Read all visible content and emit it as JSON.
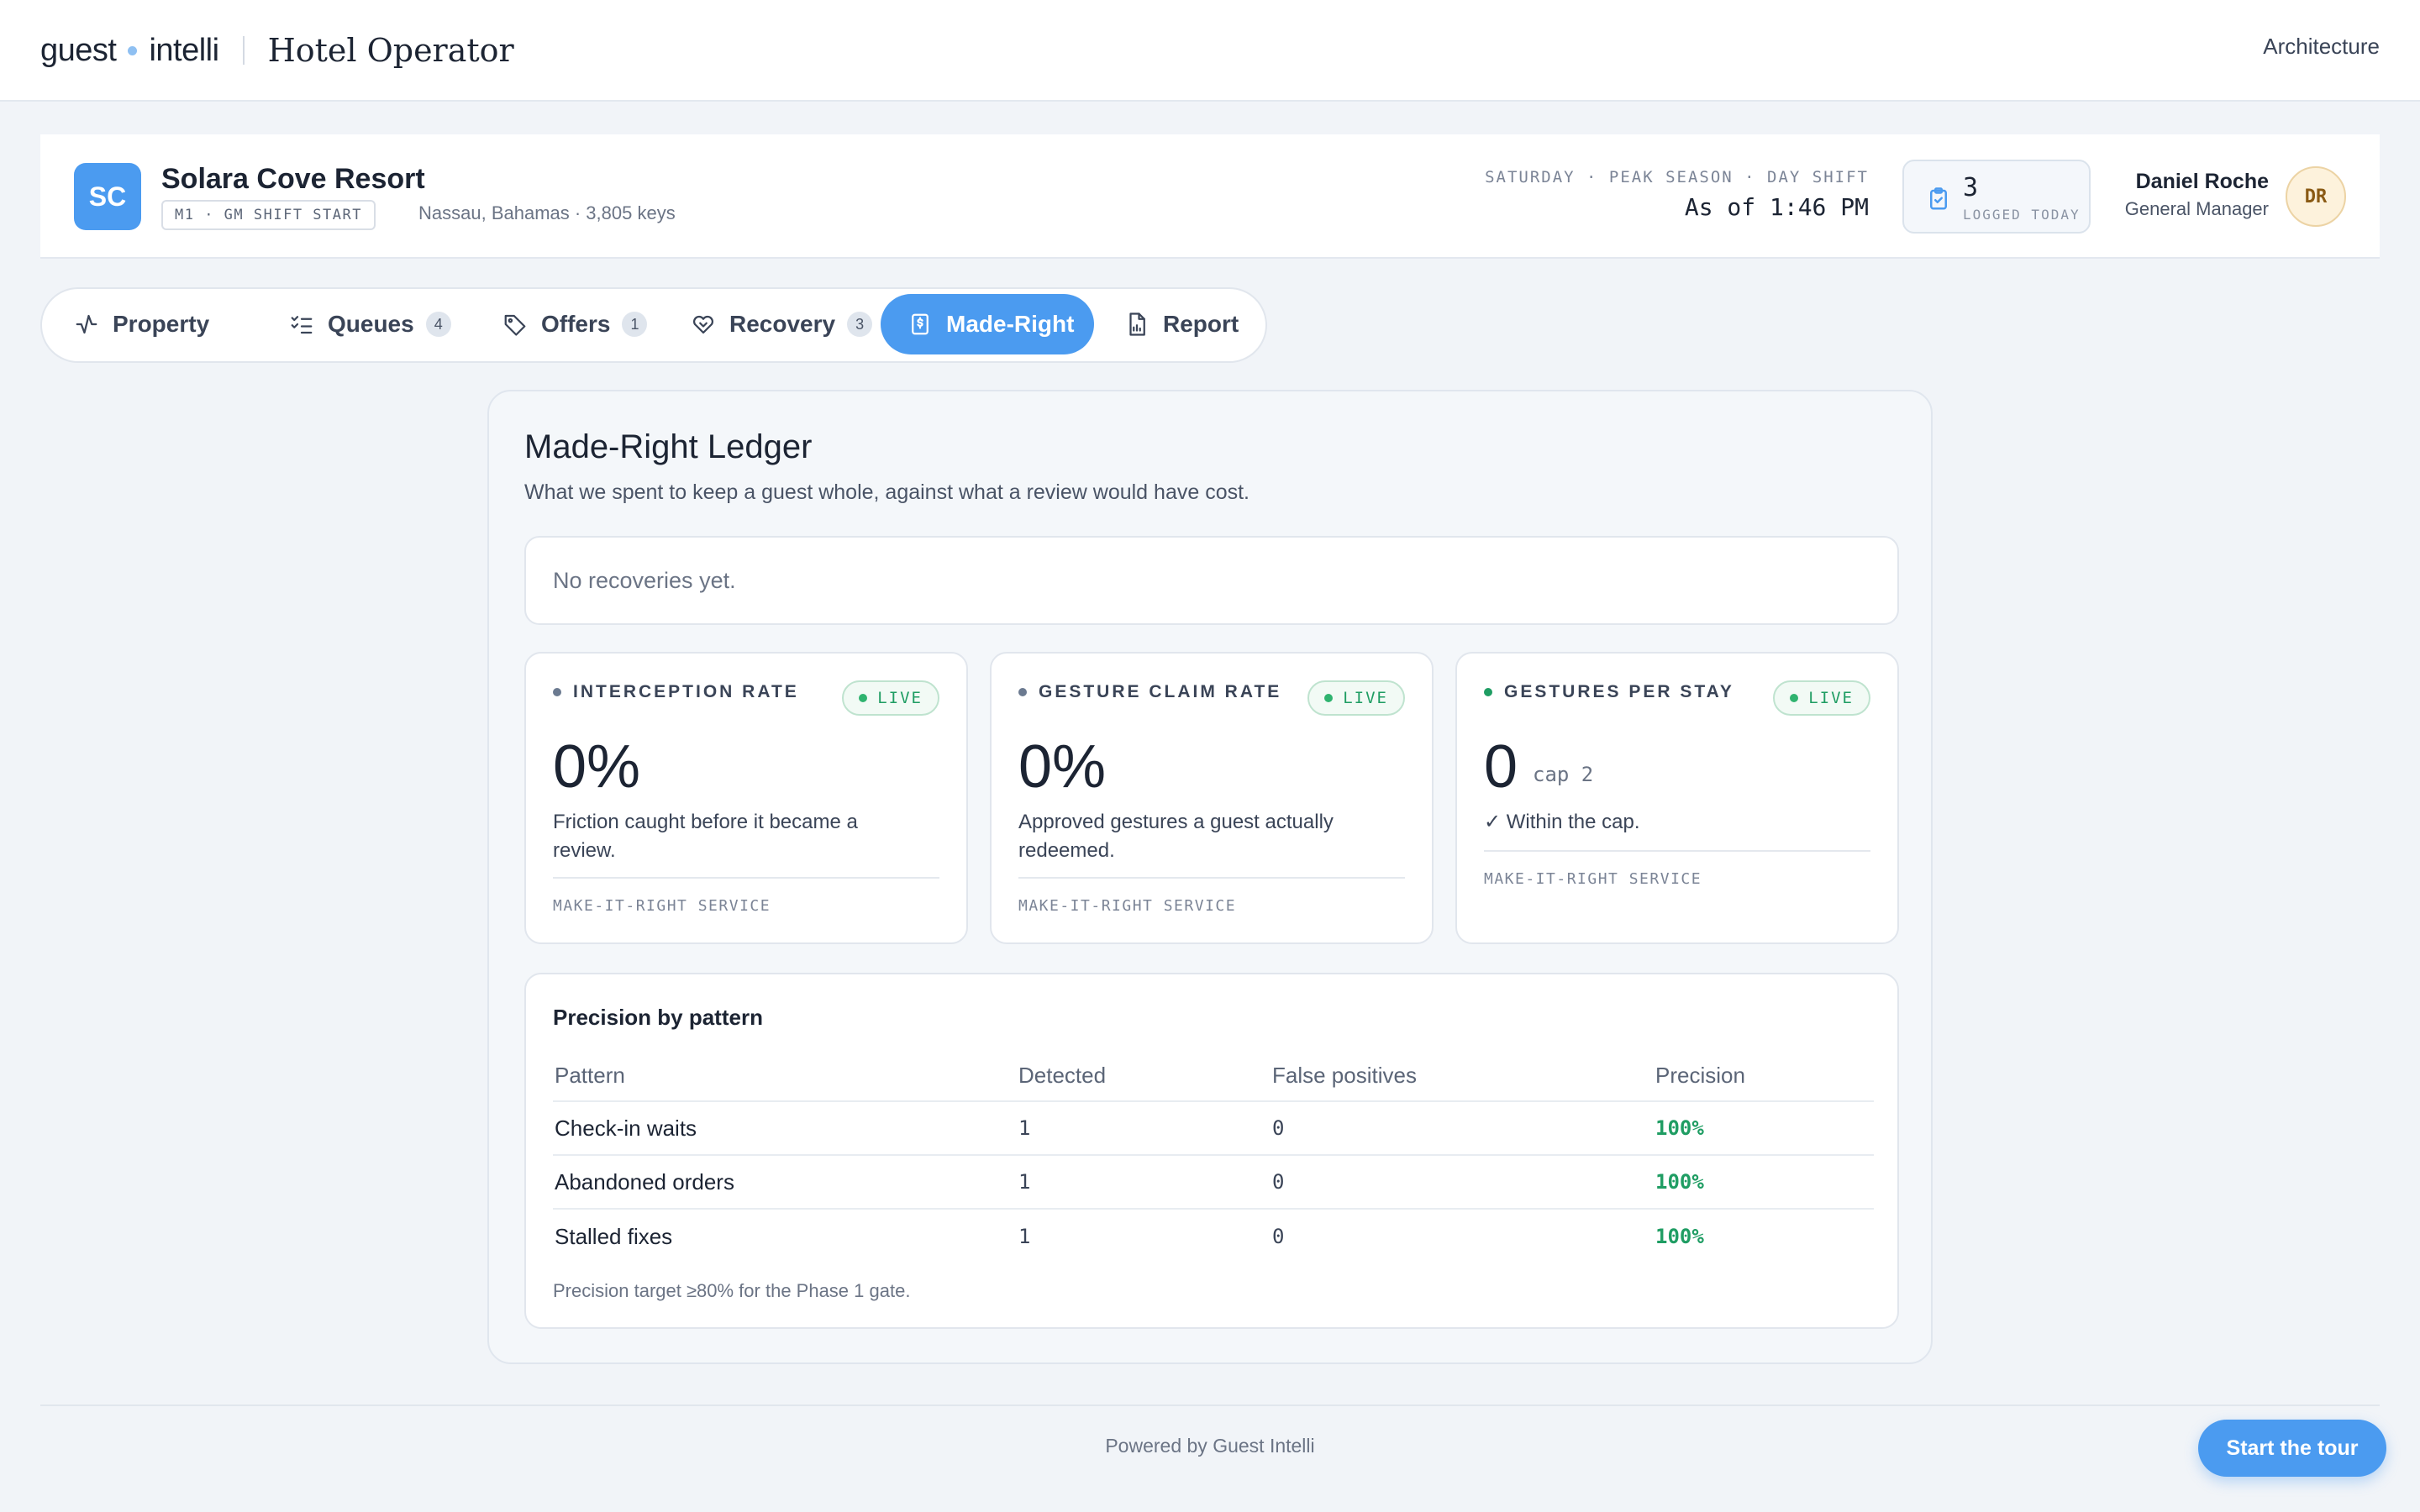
{
  "brand": {
    "left": "guest",
    "right": "intelli",
    "product": "Hotel Operator"
  },
  "nav": {
    "architecture": "Architecture"
  },
  "property": {
    "initials": "SC",
    "name": "Solara Cove Resort",
    "tag": "M1 · GM SHIFT START",
    "location": "Nassau, Bahamas · 3,805 keys",
    "shift_label": "SATURDAY · PEAK SEASON · DAY SHIFT",
    "as_of": "As of 1:46 PM",
    "logged_count": "3",
    "logged_label": "LOGGED TODAY",
    "user_name": "Daniel Roche",
    "user_role": "General Manager",
    "user_initials": "DR"
  },
  "tabs": [
    {
      "label": "Property",
      "icon": "activity-icon"
    },
    {
      "label": "Queues",
      "badge": "4",
      "icon": "checklist-icon"
    },
    {
      "label": "Offers",
      "badge": "1",
      "icon": "tag-icon"
    },
    {
      "label": "Recovery",
      "badge": "3",
      "icon": "heart-handshake-icon"
    },
    {
      "label": "Made-Right",
      "icon": "receipt-dollar-icon",
      "active": true
    },
    {
      "label": "Report",
      "icon": "file-chart-icon"
    }
  ],
  "ledger": {
    "title": "Made-Right Ledger",
    "subtitle": "What we spent to keep a guest whole, against what a review would have cost.",
    "empty": "No recoveries yet."
  },
  "metrics": [
    {
      "label": "INTERCEPTION RATE",
      "live": "LIVE",
      "value": "0%",
      "desc": "Friction caught before it became a review.",
      "source": "MAKE-IT-RIGHT SERVICE",
      "dot": "#6b7a90"
    },
    {
      "label": "GESTURE CLAIM RATE",
      "live": "LIVE",
      "value": "0%",
      "desc": "Approved gestures a guest actually redeemed.",
      "source": "MAKE-IT-RIGHT SERVICE",
      "dot": "#6b7a90"
    },
    {
      "label": "GESTURES PER STAY",
      "live": "LIVE",
      "value": "0",
      "cap": "cap 2",
      "desc": "✓ Within the cap.",
      "source": "MAKE-IT-RIGHT SERVICE",
      "dot": "#1f9d63"
    }
  ],
  "precision": {
    "title": "Precision by pattern",
    "columns": [
      "Pattern",
      "Detected",
      "False positives",
      "Precision"
    ],
    "rows": [
      [
        "Check-in waits",
        "1",
        "0",
        "100%"
      ],
      [
        "Abandoned orders",
        "1",
        "0",
        "100%"
      ],
      [
        "Stalled fixes",
        "1",
        "0",
        "100%"
      ]
    ],
    "note": "Precision target ≥80% for the Phase 1 gate."
  },
  "footer": {
    "powered": "Powered by Guest Intelli",
    "tour": "Start the tour"
  },
  "colors": {
    "accent": "#4b9bf0",
    "success": "#1f9d63",
    "background": "#f1f4f8"
  }
}
